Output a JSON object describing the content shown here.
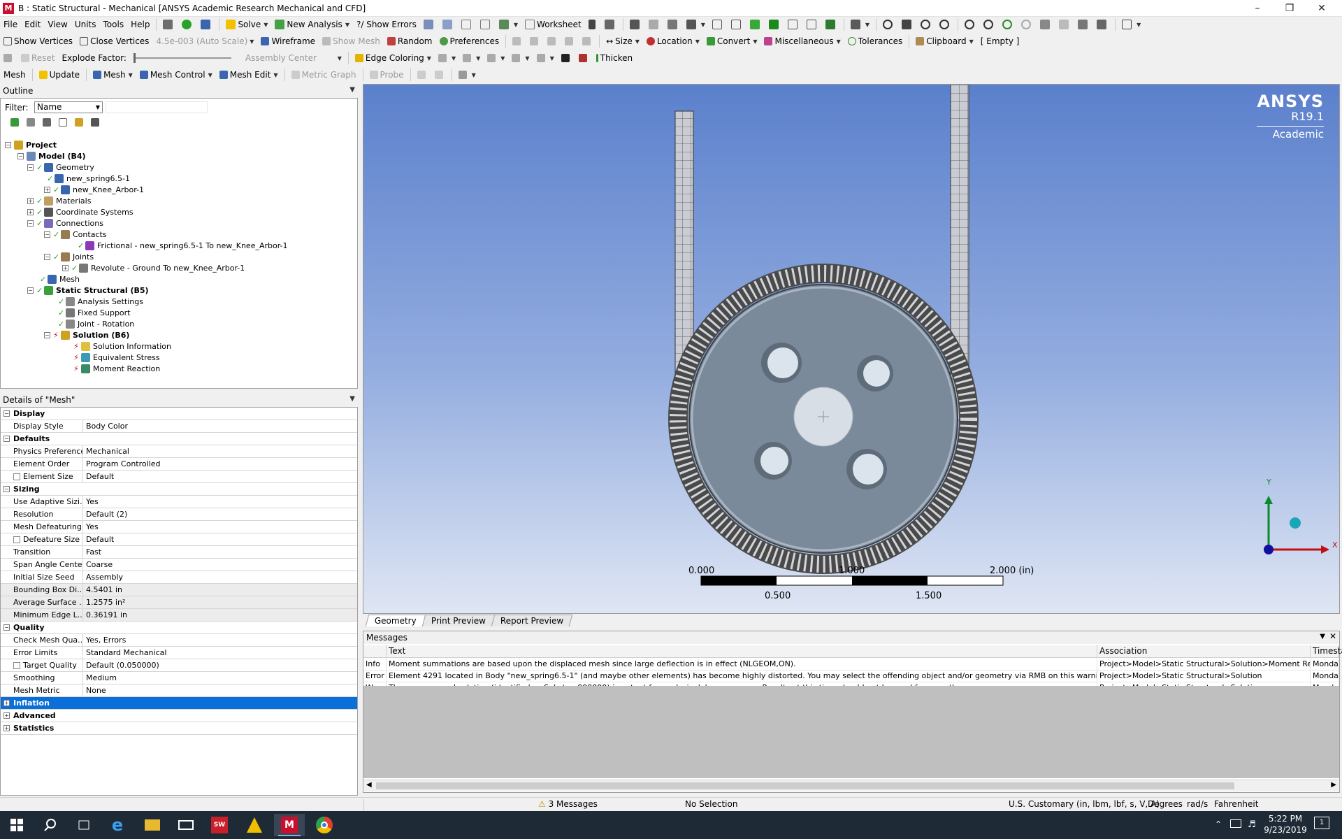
{
  "window": {
    "title": "B : Static Structural - Mechanical [ANSYS Academic Research Mechanical and CFD]",
    "app_icon": "M"
  },
  "menu": [
    "File",
    "Edit",
    "View",
    "Units",
    "Tools",
    "Help"
  ],
  "toolbar1": {
    "solve": "Solve",
    "new_analysis": "New Analysis",
    "show_errors": "?/ Show Errors",
    "worksheet": "Worksheet"
  },
  "toolbar2": {
    "show_vertices": "Show Vertices",
    "close_vertices": "Close Vertices",
    "scale": "4.5e-003 (Auto Scale)",
    "wireframe": "Wireframe",
    "show_mesh": "Show Mesh",
    "random": "Random",
    "preferences": "Preferences",
    "size": "Size",
    "location": "Location",
    "convert": "Convert",
    "miscellaneous": "Miscellaneous",
    "tolerances": "Tolerances",
    "clipboard": "Clipboard",
    "clipboard_value": "[ Empty ]"
  },
  "toolbar3": {
    "reset": "Reset",
    "explode_factor": "Explode Factor:",
    "assembly_center": "Assembly Center",
    "edge_coloring": "Edge Coloring",
    "thicken": "Thicken"
  },
  "toolbar4": {
    "mesh": "Mesh",
    "update": "Update",
    "mesh_menu": "Mesh",
    "mesh_control": "Mesh Control",
    "mesh_edit": "Mesh Edit",
    "metric_graph": "Metric Graph",
    "probe": "Probe"
  },
  "outline": {
    "title": "Outline",
    "filter_label": "Filter:",
    "filter_value": "Name",
    "tree": [
      {
        "label": "Project",
        "bold": true
      },
      {
        "label": "Model (B4)",
        "bold": true
      },
      {
        "label": "Geometry"
      },
      {
        "label": "new_spring6.5-1"
      },
      {
        "label": "new_Knee_Arbor-1"
      },
      {
        "label": "Materials"
      },
      {
        "label": "Coordinate Systems"
      },
      {
        "label": "Connections"
      },
      {
        "label": "Contacts"
      },
      {
        "label": "Frictional - new_spring6.5-1 To new_Knee_Arbor-1"
      },
      {
        "label": "Joints"
      },
      {
        "label": "Revolute - Ground To new_Knee_Arbor-1"
      },
      {
        "label": "Mesh"
      },
      {
        "label": "Static Structural (B5)",
        "bold": true
      },
      {
        "label": "Analysis Settings"
      },
      {
        "label": "Fixed Support"
      },
      {
        "label": "Joint - Rotation"
      },
      {
        "label": "Solution (B6)",
        "bold": true
      },
      {
        "label": "Solution Information"
      },
      {
        "label": "Equivalent Stress"
      },
      {
        "label": "Moment Reaction"
      }
    ]
  },
  "details": {
    "title": "Details of \"Mesh\"",
    "rows": [
      {
        "k": "Display",
        "group": true
      },
      {
        "k": "Display Style",
        "v": "Body Color"
      },
      {
        "k": "Defaults",
        "group": true
      },
      {
        "k": "Physics Preference",
        "v": "Mechanical"
      },
      {
        "k": "Element Order",
        "v": "Program Controlled"
      },
      {
        "k": "Element Size",
        "v": "Default"
      },
      {
        "k": "Sizing",
        "group": true
      },
      {
        "k": "Use Adaptive Sizi...",
        "v": "Yes"
      },
      {
        "k": "Resolution",
        "v": "Default (2)"
      },
      {
        "k": "Mesh Defeaturing",
        "v": "Yes"
      },
      {
        "k": "Defeature Size",
        "v": "Default"
      },
      {
        "k": "Transition",
        "v": "Fast"
      },
      {
        "k": "Span Angle Center",
        "v": "Coarse"
      },
      {
        "k": "Initial Size Seed",
        "v": "Assembly"
      },
      {
        "k": "Bounding Box Di...",
        "v": "4.5401 in"
      },
      {
        "k": "Average Surface ...",
        "v": "1.2575 in²"
      },
      {
        "k": "Minimum Edge L...",
        "v": "0.36191 in"
      },
      {
        "k": "Quality",
        "group": true
      },
      {
        "k": "Check Mesh Qua...",
        "v": "Yes, Errors"
      },
      {
        "k": "Error Limits",
        "v": "Standard Mechanical"
      },
      {
        "k": "Target Quality",
        "v": "Default (0.050000)"
      },
      {
        "k": "Smoothing",
        "v": "Medium"
      },
      {
        "k": "Mesh Metric",
        "v": "None"
      },
      {
        "k": "Inflation",
        "group": true
      },
      {
        "k": "Advanced",
        "group": true
      },
      {
        "k": "Statistics",
        "group": true
      }
    ]
  },
  "viewport": {
    "brand": "ANSYS",
    "version": "R19.1",
    "edition": "Academic",
    "scale_labels_top": [
      "0.000",
      "1.000",
      "2.000 (in)"
    ],
    "scale_labels_bottom": [
      "0.500",
      "1.500"
    ],
    "axis_y": "Y",
    "axis_x": "X"
  },
  "view_tabs": [
    "Geometry",
    "Print Preview",
    "Report Preview"
  ],
  "messages": {
    "title": "Messages",
    "columns": [
      "Text",
      "Association",
      "Timestamp"
    ],
    "rows": [
      {
        "type": "Info",
        "text": "Moment summations are based upon the displaced mesh since large deflection is in effect (NLGEOM,ON).",
        "assoc": "Project>Model>Static Structural>Solution>Moment Rea",
        "time": "Monday, Septe"
      },
      {
        "type": "Error",
        "text": "Element 4291 located in Body \"new_spring6.5-1\" (and maybe other elements) has become highly distorted.  You may select the offending object and/or geometry via RMB on this warnin",
        "assoc": "Project>Model>Static Structural>Solution",
        "time": "Monday, Septe"
      },
      {
        "type": "Warr",
        "text": "The unconverged solution (identified as Substep 999999) is output for analysis debug purposes. Results at this time should not be used for any other purpose.",
        "assoc": "Project>Model>Static Structural>Solution",
        "time": "Monday, Septe"
      }
    ]
  },
  "status": {
    "messages": "3 Messages",
    "selection": "No Selection",
    "units": "U.S. Customary (in, lbm, lbf, s, V, A)",
    "angle": "Degrees",
    "rate": "rad/s",
    "temp": "Fahrenheit"
  },
  "taskbar": {
    "time": "5:22 PM",
    "date": "9/23/2019",
    "notif_count": "1"
  }
}
